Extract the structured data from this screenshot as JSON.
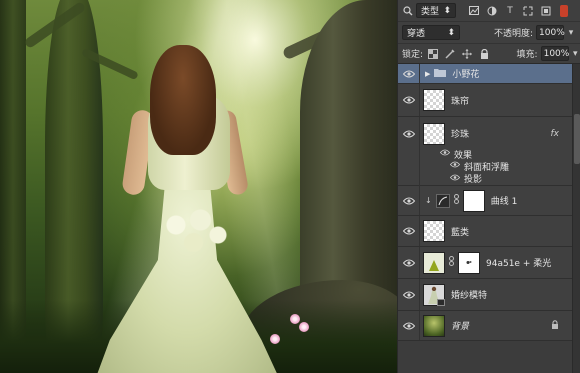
{
  "panel": {
    "filter_kind": "类型",
    "blend_mode": "穿透",
    "opacity_label": "不透明度:",
    "opacity_value": "100%",
    "lock_label": "锁定:",
    "fill_label": "填充:",
    "fill_value": "100%"
  },
  "layers": [
    {
      "name": "小野花",
      "type": "group",
      "selected": true
    },
    {
      "name": "珠帘",
      "type": "layer"
    },
    {
      "name": "珍珠",
      "type": "layer",
      "fx": "fx",
      "effects_label": "效果",
      "effects": [
        "斜面和浮雕",
        "投影"
      ]
    },
    {
      "name": "曲线 1",
      "type": "adjustment"
    },
    {
      "name": "藍类",
      "type": "layer"
    },
    {
      "name": "94a51e + 柔光",
      "type": "fill"
    },
    {
      "name": "婚纱模特",
      "type": "layer"
    },
    {
      "name": "背景",
      "type": "background",
      "locked": true
    }
  ],
  "icons": {
    "eye": "eye-icon",
    "folder": "folder-icon",
    "chain": "link-icon",
    "lock": "lock-icon",
    "fx": "fx-icon"
  },
  "colors": {
    "panel_bg": "#3c3c3c",
    "selected_row": "#5b6f8c",
    "filter_toggle": "#c8412a"
  }
}
